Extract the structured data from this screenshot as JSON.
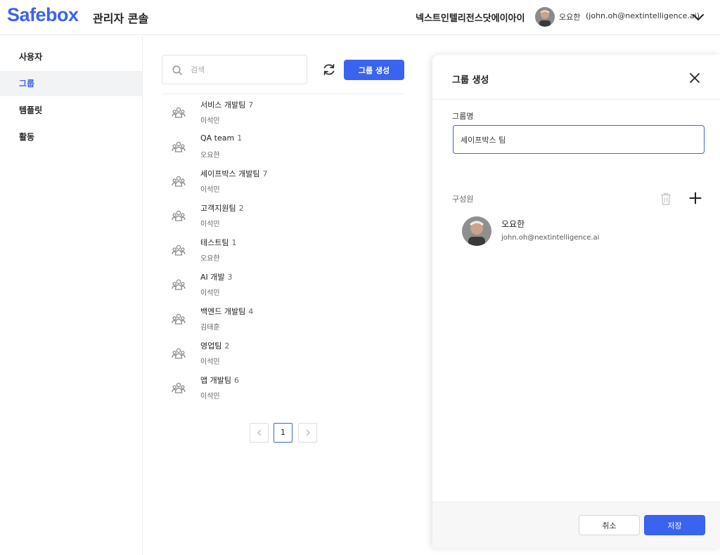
{
  "header": {
    "logo": "Safebox",
    "console_title": "관리자 콘솔",
    "org_name": "넥스트인텔리전스닷에이아이",
    "user_name": "오요한",
    "user_email": "(john.oh@nextintelligence.ai)"
  },
  "sidebar": {
    "items": [
      {
        "label": "사용자",
        "active": false
      },
      {
        "label": "그룹",
        "active": true
      },
      {
        "label": "템플릿",
        "active": false
      },
      {
        "label": "활동",
        "active": false
      }
    ]
  },
  "toolbar": {
    "search_placeholder": "검색",
    "search_value": "",
    "create_label": "그룹 생성"
  },
  "groups": [
    {
      "name": "서비스 개발팀",
      "count": "7",
      "owner": "이석민"
    },
    {
      "name": "QA team",
      "count": "1",
      "owner": "오요한"
    },
    {
      "name": "세이프박스 개발팀",
      "count": "7",
      "owner": "이석민"
    },
    {
      "name": "고객지원팀",
      "count": "2",
      "owner": "이석민"
    },
    {
      "name": "테스트팀",
      "count": "1",
      "owner": "오요한"
    },
    {
      "name": "AI 개발",
      "count": "3",
      "owner": "이석민"
    },
    {
      "name": "백엔드 개발팀",
      "count": "4",
      "owner": "김태훈"
    },
    {
      "name": "영업팀",
      "count": "2",
      "owner": "이석민"
    },
    {
      "name": "앱 개발팀",
      "count": "6",
      "owner": "이석민"
    }
  ],
  "pagination": {
    "current_page": "1"
  },
  "panel": {
    "title": "그룹 생성",
    "name_label": "그룹명",
    "name_value": "세이프박스 팀",
    "members_label": "구성원",
    "member": {
      "name": "오요한",
      "email": "john.oh@nextintelligence.ai"
    },
    "cancel_label": "취소",
    "save_label": "저장"
  },
  "colors": {
    "accent": "#3a63ef",
    "border": "#ececec",
    "sidebar_active_bg": "#f2f3f5"
  },
  "icons": [
    "search-icon",
    "refresh-icon",
    "group-icon",
    "chevron-left-icon",
    "chevron-right-icon",
    "close-icon",
    "trash-icon",
    "plus-icon",
    "chevron-down-icon"
  ]
}
